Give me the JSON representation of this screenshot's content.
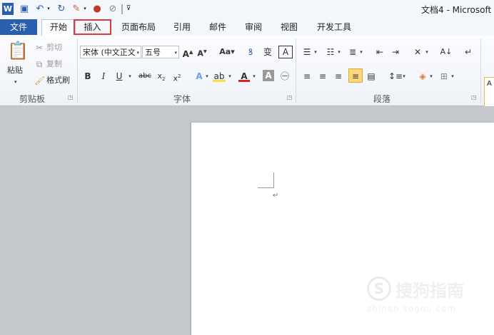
{
  "title": "文档4 - Microsoft",
  "tabs": {
    "file": "文件",
    "home": "开始",
    "insert": "插入",
    "page_layout": "页面布局",
    "references": "引用",
    "mailings": "邮件",
    "review": "审阅",
    "view": "视图",
    "developer": "开发工具"
  },
  "clipboard": {
    "paste": "粘贴",
    "cut": "剪切",
    "copy": "复制",
    "format_painter": "格式刷",
    "label": "剪贴板"
  },
  "font": {
    "font_name": "宋体 (中文正文",
    "font_size": "五号",
    "label": "字体"
  },
  "paragraph": {
    "label": "段落"
  },
  "watermark": {
    "brand": "搜狗指南",
    "url": "zhinan.sogou.com"
  },
  "styles": {
    "preview": "A"
  },
  "colors": {
    "file_tab": "#2a5fad",
    "highlight": "#e0393b",
    "accent_yellow": "#f4e24a",
    "font_red": "#e02020"
  }
}
